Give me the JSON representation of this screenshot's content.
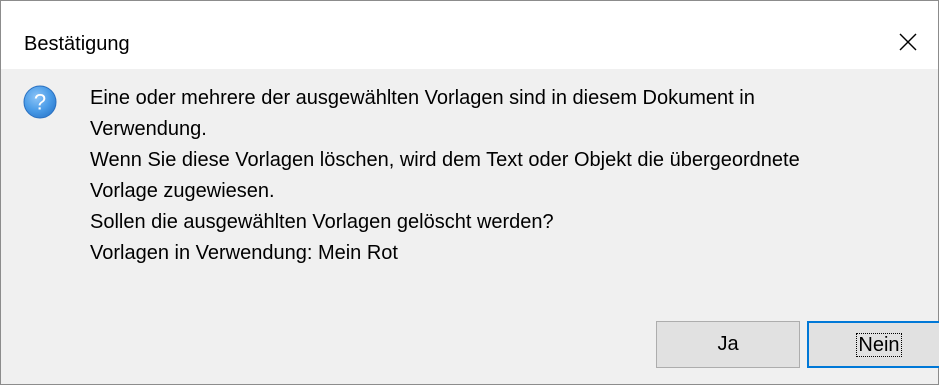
{
  "window": {
    "title": "Bestätigung",
    "close_icon": "close-icon"
  },
  "message": {
    "icon": "question-icon",
    "lines": [
      "Eine oder mehrere der ausgewählten Vorlagen sind in diesem Dokument in",
      "Verwendung.",
      "Wenn Sie diese Vorlagen löschen, wird dem Text oder Objekt die übergeordnete",
      "Vorlage zugewiesen.",
      "Sollen die ausgewählten Vorlagen gelöscht werden?",
      "Vorlagen in Verwendung: Mein Rot"
    ]
  },
  "buttons": {
    "yes_label": "Ja",
    "no_label": "Nein"
  },
  "colors": {
    "titlebar": "#ffffff",
    "body": "#f0f0f0",
    "button_face": "#e1e1e1",
    "button_border": "#adadad",
    "default_button_border": "#0078d7",
    "icon_blue": "#3c8ee4"
  }
}
